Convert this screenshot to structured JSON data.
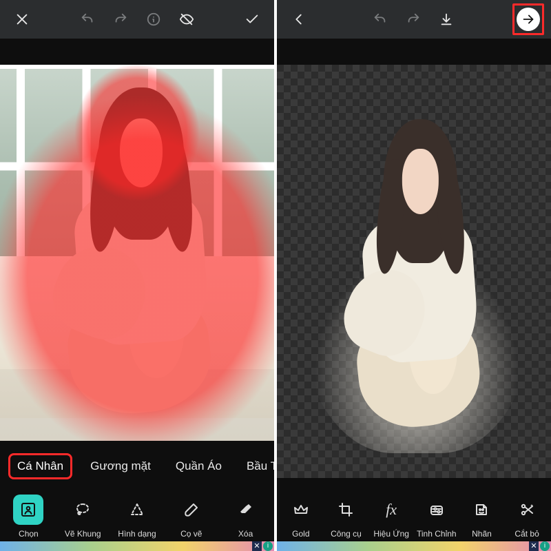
{
  "left": {
    "top_icons": [
      "close",
      "undo",
      "redo",
      "info",
      "preview",
      "confirm"
    ],
    "chips": [
      "Cá Nhân",
      "Gương mặt",
      "Quần Áo",
      "Bầu Trờ"
    ],
    "active_chip_index": 0,
    "tools": [
      {
        "id": "select",
        "label": "Chọn",
        "icon": "person-select"
      },
      {
        "id": "outline",
        "label": "Vẽ Khung",
        "icon": "lasso"
      },
      {
        "id": "shape",
        "label": "Hình dạng",
        "icon": "triangle-dashed"
      },
      {
        "id": "brush",
        "label": "Cọ vẽ",
        "icon": "brush"
      },
      {
        "id": "erase",
        "label": "Xóa",
        "icon": "eraser"
      }
    ],
    "active_tool_index": 0
  },
  "right": {
    "top_icons": [
      "back",
      "undo",
      "redo",
      "download",
      "next"
    ],
    "tools": [
      {
        "id": "gold",
        "label": "Gold",
        "icon": "crown"
      },
      {
        "id": "tools",
        "label": "Công cụ",
        "icon": "crop"
      },
      {
        "id": "fx",
        "label": "Hiệu Ứng",
        "icon": "fx"
      },
      {
        "id": "adjust",
        "label": "Tinh Chỉnh",
        "icon": "sliders"
      },
      {
        "id": "sticker",
        "label": "Nhãn",
        "icon": "sticker"
      },
      {
        "id": "cutout",
        "label": "Cắt bỏ",
        "icon": "scissors-magic"
      }
    ]
  }
}
